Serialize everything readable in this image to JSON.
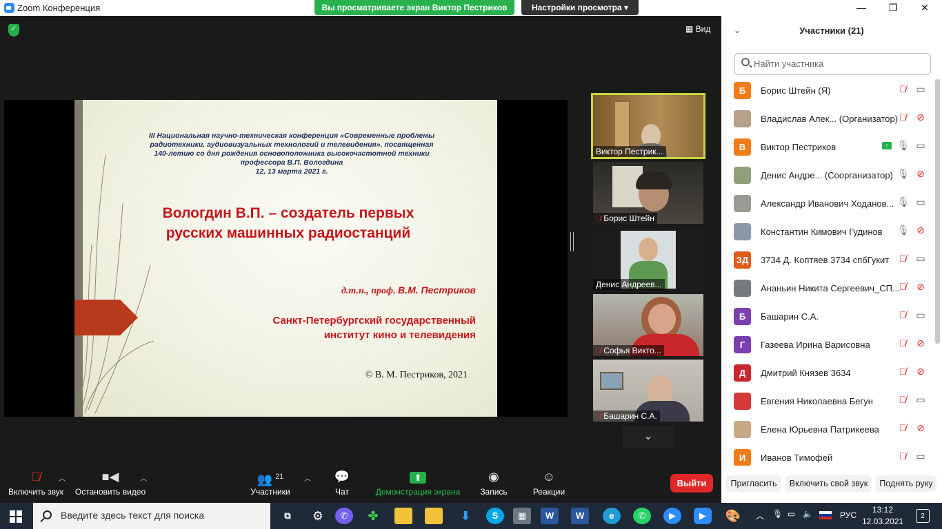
{
  "window": {
    "title": "Zoom Конференция",
    "controls": [
      "—",
      "❐",
      "✕"
    ]
  },
  "banner": {
    "viewing_text": "Вы просматриваете экран Виктор Пестриков",
    "view_settings_label": "Настройки просмотра ▾"
  },
  "top_right": {
    "view_label": "Вид"
  },
  "slide": {
    "conference_lines": [
      "III Национальная научно-техническая конференция «Современные проблемы",
      "радиотехники, аудиовизуальных технологий и телевидения», посвященная",
      "140-летию со дня рождения основоположника высокочастотной техники",
      "профессора В.П. Вологдина",
      "12, 13 марта 2021 г."
    ],
    "title_lines": [
      "Вологдин В.П. – создатель первых",
      "русских машинных радиостанций"
    ],
    "author_prefix": "д.т.н., проф.",
    "author_name": "В.М. Пестриков",
    "institute_lines": [
      "Санкт-Петербургский государственный",
      "институт кино и телевидения"
    ],
    "copyright": "© В. М. Пестриков, 2021"
  },
  "video_tiles": [
    {
      "name": "Виктор Пестрик...",
      "muted": false
    },
    {
      "name": "Борис Штейн",
      "muted": true
    },
    {
      "name": "Денис Андреев...",
      "muted": false
    },
    {
      "name": "Софья Викто...",
      "muted": true
    },
    {
      "name": "Башарин С.А.",
      "muted": true
    }
  ],
  "toolbar": {
    "unmute_label": "Включить звук",
    "stop_video_label": "Остановить видео",
    "participants_label": "Участники",
    "participants_count": "21",
    "chat_label": "Чат",
    "share_label": "Демонстрация экрана",
    "record_label": "Запись",
    "reactions_label": "Реакции",
    "leave_label": "Выйти"
  },
  "panel": {
    "header": "Участники (21)",
    "search_placeholder": "Найти участника",
    "participants": [
      {
        "initials": "Б",
        "avatar_color": "#f07c18",
        "name": "Борис Штейн (Я)",
        "mic": "muted",
        "cam": "on",
        "sharing": false
      },
      {
        "initials": "",
        "avatar_color": "#b7a18a",
        "name": "Владислав Алек...  (Организатор)",
        "mic": "muted",
        "cam": "off",
        "sharing": false
      },
      {
        "initials": "В",
        "avatar_color": "#f07c18",
        "name": "Виктор Пестриков",
        "mic": "on",
        "cam": "on",
        "sharing": true
      },
      {
        "initials": "",
        "avatar_color": "#8fa07c",
        "name": "Денис Андре...  (Соорганизатор)",
        "mic": "on",
        "cam": "off",
        "sharing": false
      },
      {
        "initials": "",
        "avatar_color": "#9a9a95",
        "name": "Александр Иванович Ходанов...",
        "mic": "on",
        "cam": "on",
        "sharing": false
      },
      {
        "initials": "",
        "avatar_color": "#8c98a8",
        "name": "Константин Кимович Гудинов",
        "mic": "on",
        "cam": "off",
        "sharing": false
      },
      {
        "initials": "ЗД",
        "avatar_color": "#e05a18",
        "name": "3734 Д. Коптяев 3734 спбГукит",
        "mic": "muted",
        "cam": "on",
        "sharing": false
      },
      {
        "initials": "",
        "avatar_color": "#777a7e",
        "name": "Ананьин Никита Сергеевич_СП...",
        "mic": "muted",
        "cam": "off",
        "sharing": false
      },
      {
        "initials": "Б",
        "avatar_color": "#7b3fb0",
        "name": "Башарин С.А.",
        "mic": "muted",
        "cam": "on",
        "sharing": false
      },
      {
        "initials": "Г",
        "avatar_color": "#7b3fb0",
        "name": "Газеева Ирина Варисовна",
        "mic": "muted",
        "cam": "off",
        "sharing": false
      },
      {
        "initials": "Д",
        "avatar_color": "#c8282e",
        "name": "Дмитрий Князев 3634",
        "mic": "muted",
        "cam": "off",
        "sharing": false
      },
      {
        "initials": "",
        "avatar_color": "#d33b3b",
        "name": "Евгения Николаевна Бегун",
        "mic": "muted",
        "cam": "on",
        "sharing": false
      },
      {
        "initials": "",
        "avatar_color": "#c9a886",
        "name": "Елена Юрьевна Патрикеева",
        "mic": "muted",
        "cam": "off",
        "sharing": false
      },
      {
        "initials": "И",
        "avatar_color": "#f07c18",
        "name": "Иванов Тимофей",
        "mic": "muted",
        "cam": "on",
        "sharing": false
      }
    ],
    "invite_label": "Пригласить",
    "unmute_self_label": "Включить свой звук",
    "raise_hand_label": "Поднять руку"
  },
  "taskbar": {
    "search_placeholder": "Введите здесь текст для поиска",
    "language": "РУС",
    "time": "13:12",
    "date": "12.03.2021",
    "notifications": "2"
  }
}
